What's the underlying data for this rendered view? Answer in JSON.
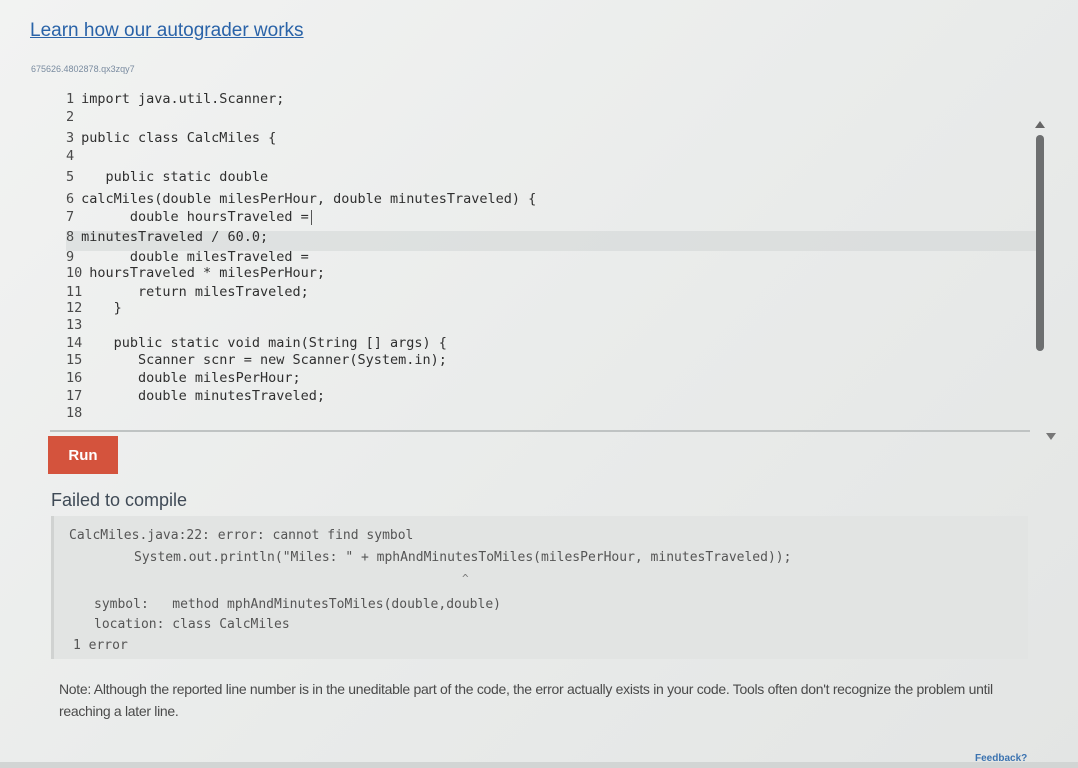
{
  "header": {
    "learn_link": "Learn how our autograder works",
    "code_id": "675626.4802878.qx3zqy7"
  },
  "editor": {
    "lines": [
      {
        "num": "1",
        "text": "import java.util.Scanner;"
      },
      {
        "num": "2",
        "text": ""
      },
      {
        "num": "3",
        "text": "public class CalcMiles {"
      },
      {
        "num": "4",
        "text": ""
      },
      {
        "num": "5",
        "text": "   public static double"
      },
      {
        "num": "6",
        "text": "calcMiles(double milesPerHour, double minutesTraveled) {"
      },
      {
        "num": "7",
        "text": "      double hoursTraveled ="
      },
      {
        "num": "8",
        "text": "minutesTraveled / 60.0;"
      },
      {
        "num": "9",
        "text": "      double milesTraveled ="
      },
      {
        "num": "10",
        "text": "hoursTraveled * milesPerHour;"
      },
      {
        "num": "11",
        "text": "      return milesTraveled;"
      },
      {
        "num": "12",
        "text": "   }"
      },
      {
        "num": "13",
        "text": ""
      },
      {
        "num": "14",
        "text": "   public static void main(String [] args) {"
      },
      {
        "num": "15",
        "text": "      Scanner scnr = new Scanner(System.in);"
      },
      {
        "num": "16",
        "text": "      double milesPerHour;"
      },
      {
        "num": "17",
        "text": "      double minutesTraveled;"
      },
      {
        "num": "18",
        "text": ""
      }
    ]
  },
  "run_button": {
    "label": "Run"
  },
  "result": {
    "title": "Failed to compile",
    "error_lines": {
      "line1": "CalcMiles.java:22: error: cannot find symbol",
      "line2": "System.out.println(\"Miles: \" + mphAndMinutesToMiles(milesPerHour, minutesTraveled));",
      "caret": "^",
      "line3": "symbol:   method mphAndMinutesToMiles(double,double)",
      "line4": "location: class CalcMiles",
      "line5": "1 error"
    }
  },
  "note": "Note: Although the reported line number is in the uneditable part of the code, the error actually exists in your code. Tools often don't recognize the problem until reaching a later line.",
  "footer": {
    "feedback_label": "Feedback?"
  },
  "colors": {
    "link": "#2a63a8",
    "run_button": "#d4533d",
    "error_box": "#e2e4e3"
  }
}
